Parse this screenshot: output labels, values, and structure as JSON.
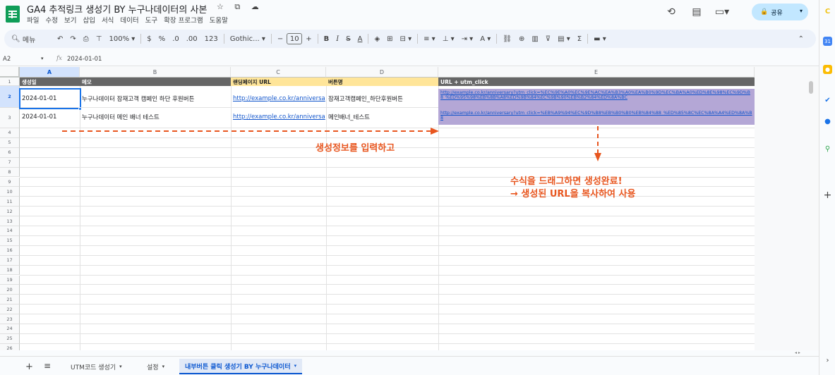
{
  "app": {
    "title": "GA4 추적링크 생성기 BY 누구나데이터의 사본",
    "title_icons": "☆ ⧉ ☁",
    "menu": [
      "파일",
      "수정",
      "보기",
      "삽입",
      "서식",
      "데이터",
      "도구",
      "확장 프로그램",
      "도움말"
    ],
    "share_label": "공유"
  },
  "toolbar": {
    "search": "메뉴",
    "zoom": "100%",
    "currency": "$",
    "percent": "%",
    "dec_decrease": ".0",
    "dec_increase": ".00",
    "format_num": "123",
    "font": "Gothic...",
    "font_size": "10",
    "bold": "B",
    "italic": "I"
  },
  "formula_bar": {
    "cell_ref": "A2",
    "formula": "2024-01-01"
  },
  "columns": [
    {
      "label": "A",
      "selected": true
    },
    {
      "label": "B",
      "selected": false
    },
    {
      "label": "C",
      "selected": false
    },
    {
      "label": "D",
      "selected": false
    },
    {
      "label": "E",
      "selected": false
    }
  ],
  "rows": [
    "1",
    "2",
    "3",
    "4",
    "5",
    "6",
    "7",
    "8",
    "9",
    "10",
    "11",
    "12",
    "13",
    "14",
    "15",
    "16",
    "17",
    "18",
    "19",
    "20",
    "21",
    "22",
    "23",
    "24",
    "25",
    "26"
  ],
  "table": {
    "headers": [
      "생성일",
      "메모",
      "랜딩페이지 URL",
      "버튼명",
      "URL + utm_click"
    ],
    "data": [
      {
        "date": "2024-01-01",
        "memo": "누구나데이터 잠재고객 캠페인 하단 후원버튼",
        "url": "http://example.co.kr/anniversa",
        "button": "잠재고객캠페인_하단후원버튼",
        "result": "http://example.co.kr/anniversary?utm_click=%EC%9E%A0%EC%9E%AC%EA%B3%A0%EA%B0%9D%EC%BA%A0%ED%8E%98%EC%9D%B8_%ED%95%98%EB%8B%A8%ED%9B%84%EC%9B%90%EB%B2%84%ED%8A%BC"
      },
      {
        "date": "2024-01-01",
        "memo": "누구나데이터 메인 배너 테스트",
        "url": "http://example.co.kr/anniversa",
        "button": "메인배너_테스트",
        "result": "http://example.co.kr/anniversary?utm_click=%EB%A9%94%EC%9D%B8%EB%B0%B0%EB%84%88_%ED%85%8C%EC%8A%A4%ED%8A%B8"
      }
    ]
  },
  "annotations": {
    "step1": "생성정보를 입력하고",
    "step2_line1": "수식을 드래그하면 생성완료!",
    "step2_line2": "→ 생성된 URL을 복사하여 사용"
  },
  "sheet_tabs": [
    {
      "label": "UTM코드 생성기",
      "active": false
    },
    {
      "label": "설정",
      "active": false
    },
    {
      "label": "내부버튼 클릭 생성기 BY 누구나데이터",
      "active": true
    }
  ],
  "colors": {
    "accent_orange": "#e8561f",
    "header_gray": "#666666",
    "header_yellow": "#ffe599",
    "result_purple": "#b4a7d6",
    "sheets_green": "#0f9d58"
  }
}
